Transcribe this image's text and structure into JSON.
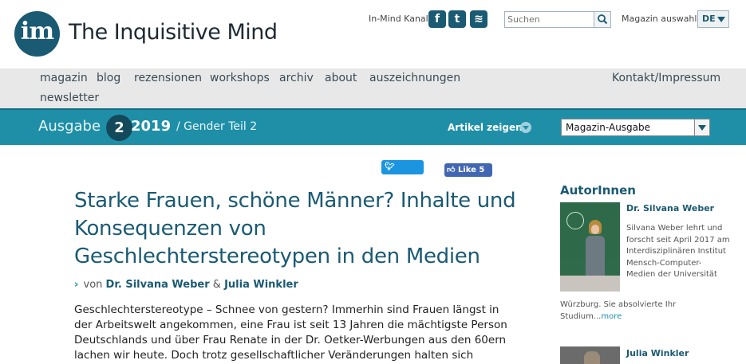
{
  "header": {
    "logo_text": "im",
    "site_title": "The Inquisitive Mind",
    "channels_label": "In-Mind Kanale",
    "social": [
      {
        "icon": "facebook-icon",
        "glyph": "f"
      },
      {
        "icon": "twitter-icon",
        "glyph": "t"
      },
      {
        "icon": "rss-icon",
        "glyph": "≋"
      }
    ],
    "search_placeholder": "Suchen",
    "magazin_label": "Magazin auswahlen",
    "lang_value": "DE"
  },
  "nav": {
    "items": [
      "magazin",
      "blog",
      "rezensionen",
      "workshops",
      "archiv",
      "about",
      "auszeichnungen",
      "newsletter"
    ],
    "contact": "Kontakt/Impressum"
  },
  "issue": {
    "ausgabe_label": "Ausgabe",
    "number": "2",
    "year": "2019",
    "topic": "/ Gender Teil 2",
    "artikel_label": "Artikel zeigen",
    "select_value": "Magazin-Ausgabe"
  },
  "share": {
    "tweet_label": "Tweet",
    "like_label": "Like 5"
  },
  "article": {
    "title": "Starke Frauen, schöne Männer? Inhalte und Konsequenzen von Geschlechterstereotypen in den Medien",
    "by_arrow": "›",
    "by_label": "von",
    "author1": "Dr. Silvana Weber",
    "amp": "&",
    "author2": "Julia Winkler",
    "body": "Geschlechterstereotype – Schnee von gestern? Immerhin sind Frauen längst in der Arbeitswelt angekommen, eine Frau ist seit 13 Jahren die mächtigste Person Deutschlands und über Frau Renate in der Dr. Oetker-Werbungen aus den 60ern lachen wir heute. Doch trotz gesellschaftlicher Veränderungen halten sich Geschlechterstereotype in Filmen, Werbung, Magazinen und auch neuen Medien"
  },
  "sidebar": {
    "heading": "AutorInnen",
    "authors": [
      {
        "name": "Dr. Silvana Weber",
        "bio_side": "Silvana Weber lehrt und forscht seit April 2017 am Interdisziplinären Institut Mensch-Computer-Medien der Universität",
        "bio_below": "Würzburg. Sie absolvierte Ihr Studium...",
        "more": "more"
      },
      {
        "name": "Julia Winkler"
      }
    ]
  },
  "colors": {
    "brand": "#1a5a73",
    "issue_bar": "#1f8fa8",
    "nav_bg": "#e8e8e8"
  }
}
